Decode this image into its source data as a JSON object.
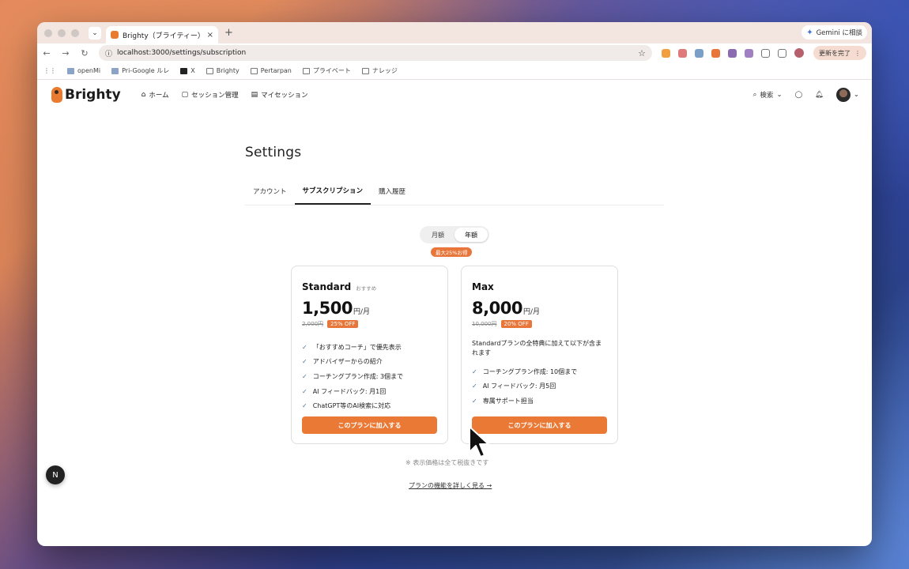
{
  "browser": {
    "tab_title": "Brighty（ブライティー）| コー",
    "tab_close": "×",
    "new_tab": "+",
    "gemini_label": "Gemini に相談",
    "url": "localhost:3000/settings/subscription",
    "update_label": "更新を完了",
    "bookmarks": [
      "openMi",
      "Pri-Google ルレ",
      "X",
      "Brighty",
      "Pertarpan",
      "プライベート",
      "ナレッジ"
    ]
  },
  "header": {
    "logo_text": "Brighty",
    "nav": [
      "ホーム",
      "セッション管理",
      "マイセッション"
    ],
    "search_label": "検索"
  },
  "page": {
    "title": "Settings",
    "tabs": [
      "アカウント",
      "サブスクリプション",
      "購入履歴"
    ],
    "active_tab": "サブスクリプション",
    "billing_options": [
      "月額",
      "年額"
    ],
    "billing_selected": "年額",
    "discount_badge": "最大25%お得",
    "tax_note": "※ 表示価格は全て税抜きです",
    "details_link": "プランの機能を詳しく見る →"
  },
  "plans": [
    {
      "name": "Standard",
      "tag": "おすすめ",
      "price": "1,500",
      "unit": "円/月",
      "old_price": "2,000円",
      "off": "25% OFF",
      "description": "",
      "features": [
        "「おすすめコーチ」で優先表示",
        "アドバイザーからの紹介",
        "コーチングプラン作成: 3個まで",
        "AI フィードバック: 月1回",
        "ChatGPT等のAI検索に対応"
      ],
      "button": "このプランに加入する"
    },
    {
      "name": "Max",
      "tag": "",
      "price": "8,000",
      "unit": "円/月",
      "old_price": "10,000円",
      "off": "20% OFF",
      "description": "Standardプランの全特典に加えて以下が含まれます",
      "features": [
        "コーチングプラン作成: 10個まで",
        "AI フィードバック: 月5回",
        "専属サポート担当"
      ],
      "button": "このプランに加入する"
    }
  ],
  "misc": {
    "next_badge": "N"
  },
  "colors": {
    "accent": "#ea7935",
    "badge": "#e8763a"
  }
}
